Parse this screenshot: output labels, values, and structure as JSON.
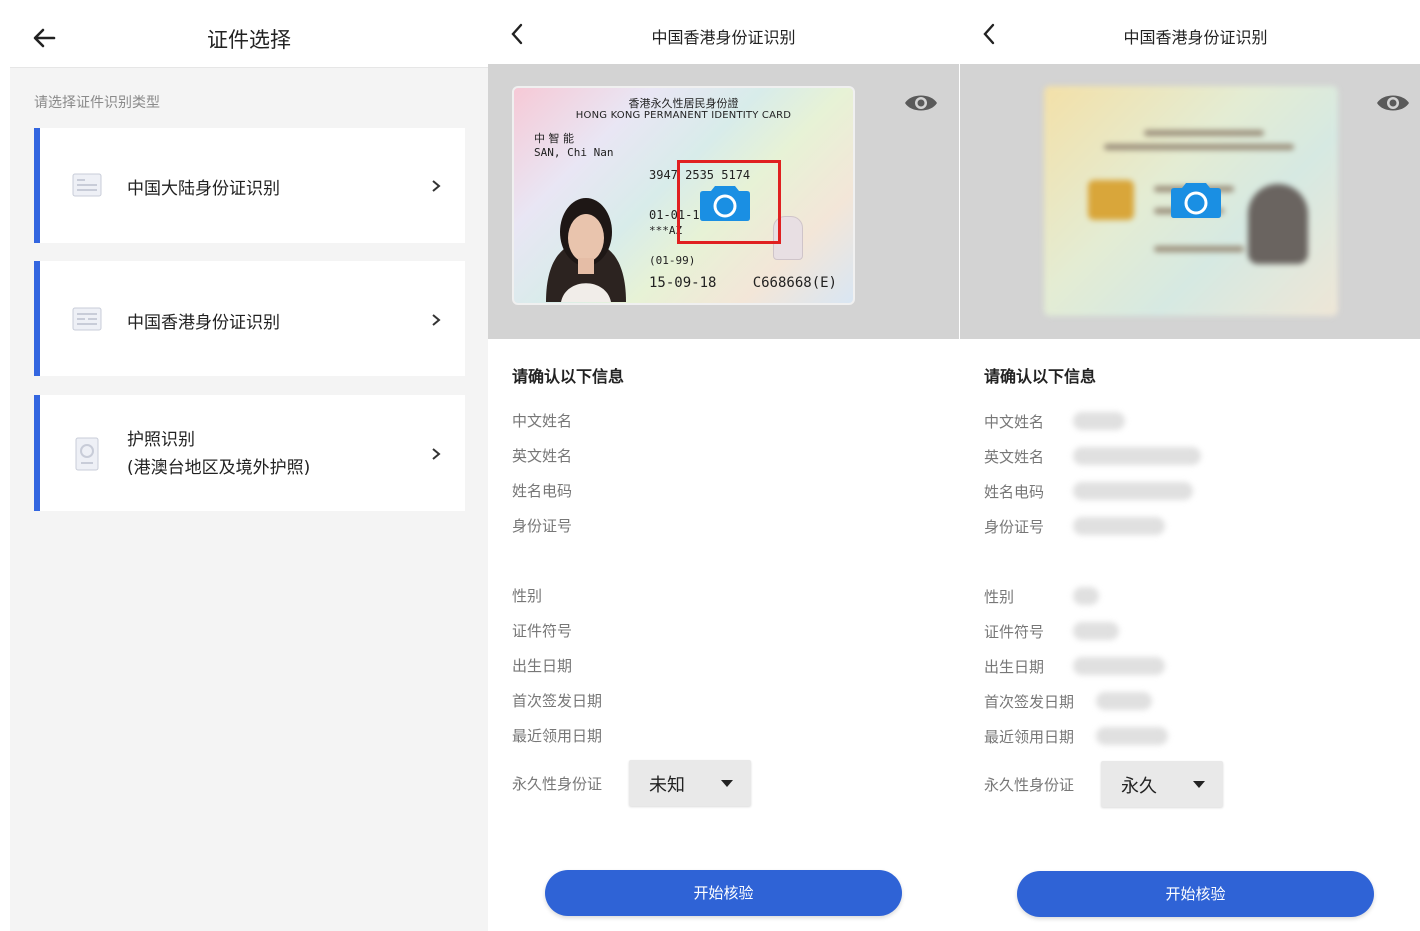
{
  "panel1": {
    "title": "证件选择",
    "subtitle": "请选择证件识别类型",
    "items": [
      {
        "label": "中国大陆身份证识别",
        "icon": "id-card-icon"
      },
      {
        "label": "中国香港身份证识别",
        "icon": "id-card-icon"
      },
      {
        "label": "护照识别",
        "sublabel": "(港澳台地区及境外护照)",
        "icon": "passport-icon"
      }
    ],
    "accent": "#3366e0"
  },
  "panel2": {
    "title": "中国香港身份证识别",
    "section_title": "请确认以下信息",
    "fields": [
      "中文姓名",
      "英文姓名",
      "姓名电码",
      "身份证号",
      "性别",
      "证件符号",
      "出生日期",
      "首次签发日期",
      "最近领用日期"
    ],
    "permanent_label": "永久性身份证",
    "permanent_value": "未知",
    "start_button": "开始核验",
    "card": {
      "title_cn": "香港永久性居民身份證",
      "title_en": "HONG KONG PERMANENT IDENTITY CARD",
      "name_cn": "中 智 能",
      "name_en": "SAN, Chi Nan",
      "code": "3947 2535 5174",
      "dob": "01-01-1990",
      "row_sym": "***AZ",
      "row_date": "(01-99)",
      "issue_date": "15-09-18",
      "id_number": "C668668(E)"
    }
  },
  "panel3": {
    "title": "中国香港身份证识别",
    "section_title": "请确认以下信息",
    "fields": [
      "中文姓名",
      "英文姓名",
      "姓名电码",
      "身份证号",
      "性别",
      "证件符号",
      "出生日期",
      "首次签发日期",
      "最近领用日期"
    ],
    "permanent_label": "永久性身份证",
    "permanent_value": "永久",
    "start_button": "开始核验"
  },
  "colors": {
    "primary": "#2f63d6",
    "camera": "#1a8fe3",
    "highlight": "#e02020"
  }
}
